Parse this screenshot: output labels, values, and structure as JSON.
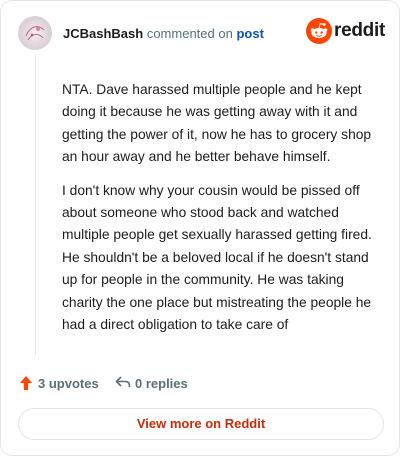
{
  "header": {
    "username": "JCBashBash",
    "commented_on": "commented on",
    "post_link": "post",
    "brand_word": "reddit"
  },
  "comment": {
    "paragraphs": [
      "NTA. Dave harassed multiple people and he kept doing it because he was getting away with it and getting the power of it, now he has to grocery shop an hour away and he better behave himself.",
      "I don't know why your cousin would be pissed off about someone who stood back and watched multiple people get sexually harassed getting fired. He shouldn't be a beloved local if he doesn't stand up for people in the community. He was taking charity the one place but mistreating the people he had a direct obligation to take care of"
    ]
  },
  "actions": {
    "upvotes": "3 upvotes",
    "replies": "0 replies"
  },
  "footer": {
    "view_more": "View more on Reddit"
  },
  "colors": {
    "brand": "#ff4500",
    "link": "#0a55b0",
    "view_more_text": "#c22d09",
    "muted": "#576f76"
  },
  "icons": {
    "avatar": "user-avatar",
    "logo": "reddit-snoo-icon",
    "upvote": "upvote-arrow-icon",
    "reply": "reply-arrow-icon"
  }
}
